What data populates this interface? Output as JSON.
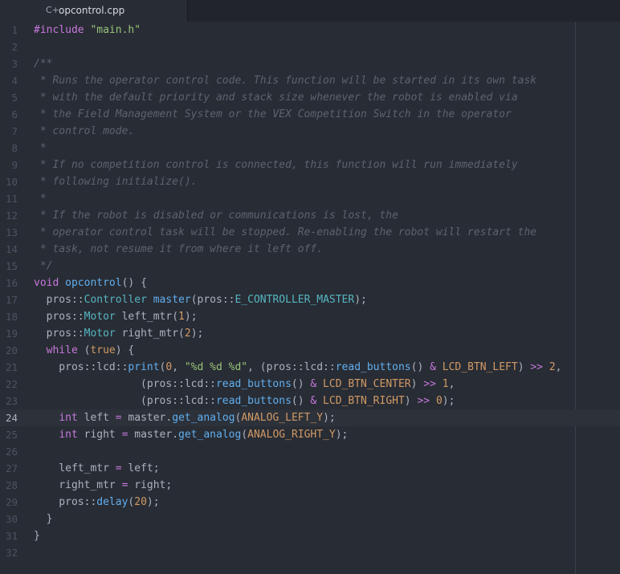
{
  "tab": {
    "icon": "cpp-file-icon",
    "label": "opcontrol.cpp"
  },
  "editor": {
    "cursor_line": 24,
    "lines": [
      {
        "num": "1",
        "tokens": [
          [
            "kw",
            "#include"
          ],
          [
            "pl",
            " "
          ],
          [
            "str",
            "\"main.h\""
          ]
        ]
      },
      {
        "num": "2",
        "tokens": []
      },
      {
        "num": "3",
        "tokens": [
          [
            "cm",
            "/**"
          ]
        ]
      },
      {
        "num": "4",
        "tokens": [
          [
            "cm",
            " * Runs the operator control code. This function will be started in its own task"
          ]
        ]
      },
      {
        "num": "5",
        "tokens": [
          [
            "cm",
            " * with the default priority and stack size whenever the robot is enabled via"
          ]
        ]
      },
      {
        "num": "6",
        "tokens": [
          [
            "cm",
            " * the Field Management System or the VEX Competition Switch in the operator"
          ]
        ]
      },
      {
        "num": "7",
        "tokens": [
          [
            "cm",
            " * control mode."
          ]
        ]
      },
      {
        "num": "8",
        "tokens": [
          [
            "cm",
            " *"
          ]
        ]
      },
      {
        "num": "9",
        "tokens": [
          [
            "cm",
            " * If no competition control is connected, this function will run immediately"
          ]
        ]
      },
      {
        "num": "10",
        "tokens": [
          [
            "cm",
            " * following initialize()."
          ]
        ]
      },
      {
        "num": "11",
        "tokens": [
          [
            "cm",
            " *"
          ]
        ]
      },
      {
        "num": "12",
        "tokens": [
          [
            "cm",
            " * If the robot is disabled or communications is lost, the"
          ]
        ]
      },
      {
        "num": "13",
        "tokens": [
          [
            "cm",
            " * operator control task will be stopped. Re-enabling the robot will restart the"
          ]
        ]
      },
      {
        "num": "14",
        "tokens": [
          [
            "cm",
            " * task, not resume it from where it left off."
          ]
        ]
      },
      {
        "num": "15",
        "tokens": [
          [
            "cm",
            " */"
          ]
        ]
      },
      {
        "num": "16",
        "tokens": [
          [
            "kw",
            "void"
          ],
          [
            "pl",
            " "
          ],
          [
            "fn",
            "opcontrol"
          ],
          [
            "pl",
            "() {"
          ]
        ]
      },
      {
        "num": "17",
        "tokens": [
          [
            "pl",
            "  pros::"
          ],
          [
            "ty",
            "Controller"
          ],
          [
            "pl",
            " "
          ],
          [
            "fn",
            "master"
          ],
          [
            "pl",
            "(pros::"
          ],
          [
            "ty",
            "E_CONTROLLER_MASTER"
          ],
          [
            "pl",
            ");"
          ]
        ]
      },
      {
        "num": "18",
        "tokens": [
          [
            "pl",
            "  pros::"
          ],
          [
            "ty",
            "Motor"
          ],
          [
            "pl",
            " left_mtr("
          ],
          [
            "num",
            "1"
          ],
          [
            "pl",
            ");"
          ]
        ]
      },
      {
        "num": "19",
        "tokens": [
          [
            "pl",
            "  pros::"
          ],
          [
            "ty",
            "Motor"
          ],
          [
            "pl",
            " right_mtr("
          ],
          [
            "num",
            "2"
          ],
          [
            "pl",
            ");"
          ]
        ]
      },
      {
        "num": "20",
        "tokens": [
          [
            "pl",
            "  "
          ],
          [
            "kw",
            "while"
          ],
          [
            "pl",
            " ("
          ],
          [
            "num",
            "true"
          ],
          [
            "pl",
            ") {"
          ]
        ]
      },
      {
        "num": "21",
        "tokens": [
          [
            "pl",
            "    pros::lcd::"
          ],
          [
            "fn",
            "print"
          ],
          [
            "pl",
            "("
          ],
          [
            "num",
            "0"
          ],
          [
            "pl",
            ", "
          ],
          [
            "str",
            "\"%d %d %d\""
          ],
          [
            "pl",
            ", (pros::lcd::"
          ],
          [
            "fn",
            "read_buttons"
          ],
          [
            "pl",
            "() "
          ],
          [
            "op",
            "&"
          ],
          [
            "pl",
            " "
          ],
          [
            "const",
            "LCD_BTN_LEFT"
          ],
          [
            "pl",
            ") "
          ],
          [
            "op",
            ">>"
          ],
          [
            "pl",
            " "
          ],
          [
            "num",
            "2"
          ],
          [
            "pl",
            ","
          ]
        ]
      },
      {
        "num": "22",
        "tokens": [
          [
            "pl",
            "                 (pros::lcd::"
          ],
          [
            "fn",
            "read_buttons"
          ],
          [
            "pl",
            "() "
          ],
          [
            "op",
            "&"
          ],
          [
            "pl",
            " "
          ],
          [
            "const",
            "LCD_BTN_CENTER"
          ],
          [
            "pl",
            ") "
          ],
          [
            "op",
            ">>"
          ],
          [
            "pl",
            " "
          ],
          [
            "num",
            "1"
          ],
          [
            "pl",
            ","
          ]
        ]
      },
      {
        "num": "23",
        "tokens": [
          [
            "pl",
            "                 (pros::lcd::"
          ],
          [
            "fn",
            "read_buttons"
          ],
          [
            "pl",
            "() "
          ],
          [
            "op",
            "&"
          ],
          [
            "pl",
            " "
          ],
          [
            "const",
            "LCD_BTN_RIGHT"
          ],
          [
            "pl",
            ") "
          ],
          [
            "op",
            ">>"
          ],
          [
            "pl",
            " "
          ],
          [
            "num",
            "0"
          ],
          [
            "pl",
            ");"
          ]
        ]
      },
      {
        "num": "24",
        "tokens": [
          [
            "pl",
            "    "
          ],
          [
            "kw",
            "int"
          ],
          [
            "pl",
            " left "
          ],
          [
            "op",
            "="
          ],
          [
            "pl",
            " master."
          ],
          [
            "fn",
            "get_analog"
          ],
          [
            "pl",
            "("
          ],
          [
            "const",
            "ANALOG_LEFT_Y"
          ],
          [
            "pl",
            ");"
          ]
        ]
      },
      {
        "num": "25",
        "tokens": [
          [
            "pl",
            "    "
          ],
          [
            "kw",
            "int"
          ],
          [
            "pl",
            " right "
          ],
          [
            "op",
            "="
          ],
          [
            "pl",
            " master."
          ],
          [
            "fn",
            "get_analog"
          ],
          [
            "pl",
            "("
          ],
          [
            "const",
            "ANALOG_RIGHT_Y"
          ],
          [
            "pl",
            ");"
          ]
        ]
      },
      {
        "num": "26",
        "tokens": []
      },
      {
        "num": "27",
        "tokens": [
          [
            "pl",
            "    left_mtr "
          ],
          [
            "op",
            "="
          ],
          [
            "pl",
            " left;"
          ]
        ]
      },
      {
        "num": "28",
        "tokens": [
          [
            "pl",
            "    right_mtr "
          ],
          [
            "op",
            "="
          ],
          [
            "pl",
            " right;"
          ]
        ]
      },
      {
        "num": "29",
        "tokens": [
          [
            "pl",
            "    pros::"
          ],
          [
            "fn",
            "delay"
          ],
          [
            "pl",
            "("
          ],
          [
            "num",
            "20"
          ],
          [
            "pl",
            ");"
          ]
        ]
      },
      {
        "num": "30",
        "tokens": [
          [
            "pl",
            "  }"
          ]
        ]
      },
      {
        "num": "31",
        "tokens": [
          [
            "pl",
            "}"
          ]
        ]
      },
      {
        "num": "32",
        "tokens": []
      }
    ]
  }
}
